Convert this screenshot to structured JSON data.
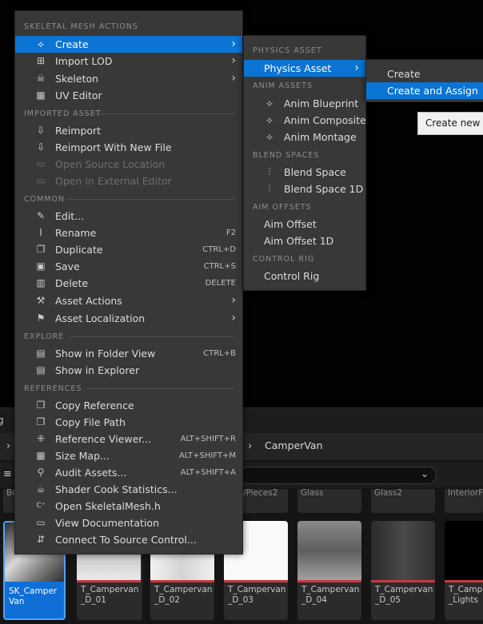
{
  "main_menu": {
    "sections": [
      {
        "title": "SKELETAL MESH ACTIONS"
      },
      {
        "title": "IMPORTED ASSET"
      },
      {
        "title": "COMMON"
      },
      {
        "title": "EXPLORE"
      },
      {
        "title": "REFERENCES"
      }
    ],
    "items": [
      {
        "label": "Create",
        "icon": "create-icon",
        "submenu": true
      },
      {
        "label": "Import LOD",
        "icon": "import-lod-icon",
        "submenu": true
      },
      {
        "label": "Skeleton",
        "icon": "skeleton-icon",
        "submenu": true
      },
      {
        "label": "UV Editor",
        "icon": "uv-editor-icon"
      },
      {
        "label": "Reimport",
        "icon": "reimport-icon"
      },
      {
        "label": "Reimport With New File",
        "icon": "reimport-new-file-icon"
      },
      {
        "label": "Open Source Location",
        "icon": "open-source-location-icon",
        "disabled": true
      },
      {
        "label": "Open In External Editor",
        "icon": "external-editor-icon",
        "disabled": true
      },
      {
        "label": "Edit...",
        "icon": "edit-icon"
      },
      {
        "label": "Rename",
        "icon": "rename-icon",
        "shortcut": "F2"
      },
      {
        "label": "Duplicate",
        "icon": "duplicate-icon",
        "shortcut": "CTRL+D"
      },
      {
        "label": "Save",
        "icon": "save-icon",
        "shortcut": "CTRL+S"
      },
      {
        "label": "Delete",
        "icon": "delete-icon",
        "shortcut": "DELETE"
      },
      {
        "label": "Asset Actions",
        "icon": "wrench-icon",
        "submenu": true
      },
      {
        "label": "Asset Localization",
        "icon": "flag-icon",
        "submenu": true
      },
      {
        "label": "Show in Folder View",
        "icon": "folder-view-icon",
        "shortcut": "CTRL+B"
      },
      {
        "label": "Show in Explorer",
        "icon": "explorer-icon"
      },
      {
        "label": "Copy Reference",
        "icon": "copy-reference-icon"
      },
      {
        "label": "Copy File Path",
        "icon": "copy-file-path-icon"
      },
      {
        "label": "Reference Viewer...",
        "icon": "reference-viewer-icon",
        "shortcut": "ALT+SHIFT+R"
      },
      {
        "label": "Size Map...",
        "icon": "size-map-icon",
        "shortcut": "ALT+SHIFT+M"
      },
      {
        "label": "Audit Assets...",
        "icon": "audit-assets-icon",
        "shortcut": "ALT+SHIFT+A"
      },
      {
        "label": "Shader Cook Statistics...",
        "icon": "shader-stats-icon"
      },
      {
        "label": "Open SkeletalMesh.h",
        "icon": "cpp-file-icon"
      },
      {
        "label": "View Documentation",
        "icon": "documentation-icon"
      },
      {
        "label": "Connect To Source Control...",
        "icon": "source-control-icon"
      }
    ]
  },
  "create_submenu": {
    "sections": [
      {
        "title": "PHYSICS ASSET"
      },
      {
        "title": "ANIM ASSETS"
      },
      {
        "title": "BLEND SPACES"
      },
      {
        "title": "AIM OFFSETS"
      },
      {
        "title": "CONTROL RIG"
      }
    ],
    "items": [
      {
        "label": "Physics Asset",
        "submenu": true
      },
      {
        "label": "Anim Blueprint",
        "icon": "anim-blueprint-icon"
      },
      {
        "label": "Anim Composite",
        "icon": "anim-composite-icon"
      },
      {
        "label": "Anim Montage",
        "icon": "anim-montage-icon"
      },
      {
        "label": "Blend Space",
        "icon": "blend-space-icon"
      },
      {
        "label": "Blend Space 1D",
        "icon": "blend-space-1d-icon"
      },
      {
        "label": "Aim Offset"
      },
      {
        "label": "Aim Offset 1D"
      },
      {
        "label": "Control Rig"
      }
    ]
  },
  "physics_submenu": {
    "items": [
      {
        "label": "Create"
      },
      {
        "label": "Create and Assign"
      }
    ]
  },
  "tooltip": {
    "text": "Create new pl"
  },
  "content_browser": {
    "tab_fragment": "g",
    "path": {
      "folder": "CamperVan"
    },
    "previous_row_labels": [
      "Bo",
      "/Pieces2",
      "Glass",
      "Glass2",
      "InteriorFr"
    ],
    "tiles": [
      {
        "name": "SK_Camper\nVan",
        "selected": true
      },
      {
        "name": "T_Campervan\n_D_01"
      },
      {
        "name": "T_Campervan\n_D_02"
      },
      {
        "name": "T_Campervan\n_D_03"
      },
      {
        "name": "T_Campervan\n_D_04"
      },
      {
        "name": "T_Campervan\n_D_05"
      },
      {
        "name": "T_Camp\n_Lights"
      }
    ]
  },
  "colors": {
    "highlight": "#0b74d4",
    "menu_bg": "#383838",
    "accent_strip": "#c8383f"
  }
}
